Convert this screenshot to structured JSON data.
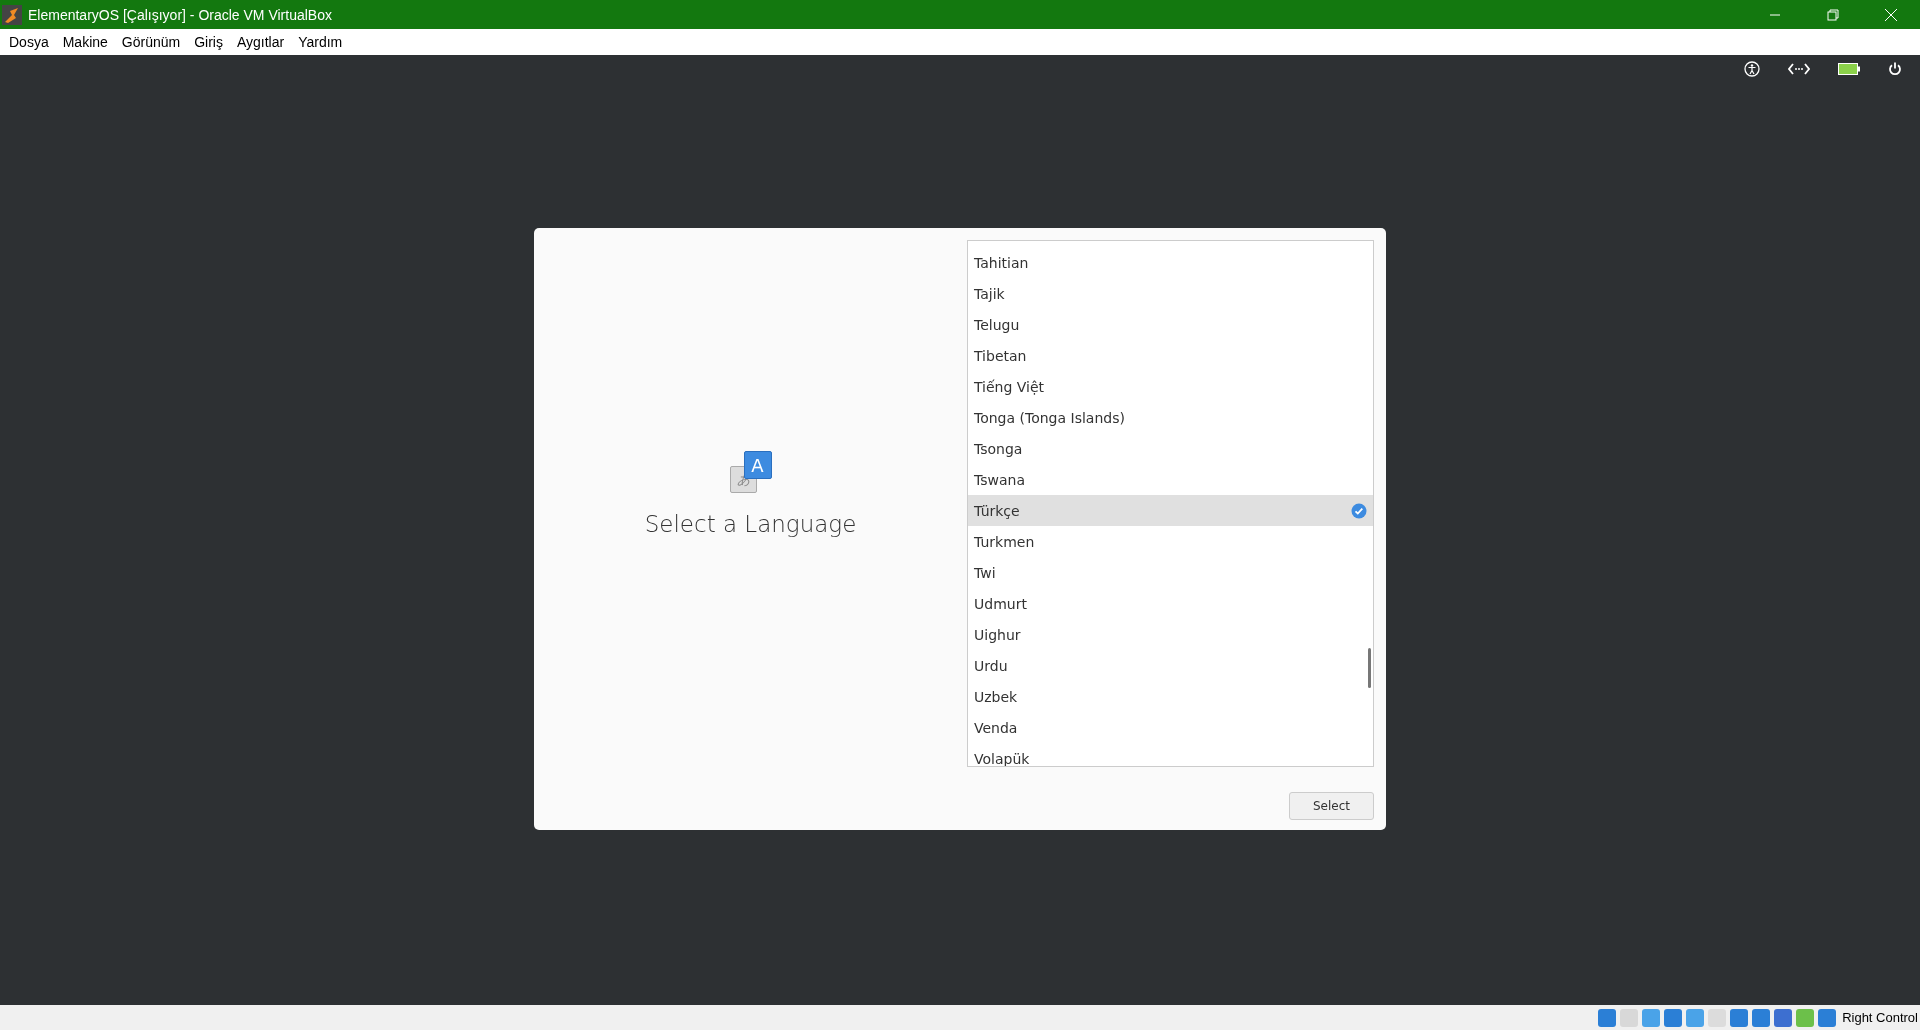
{
  "window": {
    "title": "ElementaryOS [Çalışıyor] - Oracle VM VirtualBox"
  },
  "menu": [
    "Dosya",
    "Makine",
    "Görünüm",
    "Giriş",
    "Aygıtlar",
    "Yardım"
  ],
  "dialog": {
    "heading": "Select a Language",
    "icon_letter": "A",
    "icon_glyph": "あ",
    "languages": [
      {
        "name": "Tahitian",
        "selected": false
      },
      {
        "name": "Tajik",
        "selected": false
      },
      {
        "name": "Telugu",
        "selected": false
      },
      {
        "name": "Tibetan",
        "selected": false
      },
      {
        "name": "Tiếng Việt",
        "selected": false
      },
      {
        "name": "Tonga (Tonga Islands)",
        "selected": false
      },
      {
        "name": "Tsonga",
        "selected": false
      },
      {
        "name": "Tswana",
        "selected": false
      },
      {
        "name": "Türkçe",
        "selected": true
      },
      {
        "name": "Turkmen",
        "selected": false
      },
      {
        "name": "Twi",
        "selected": false
      },
      {
        "name": "Udmurt",
        "selected": false
      },
      {
        "name": "Uighur",
        "selected": false
      },
      {
        "name": "Urdu",
        "selected": false
      },
      {
        "name": "Uzbek",
        "selected": false
      },
      {
        "name": "Venda",
        "selected": false
      },
      {
        "name": "Volapük",
        "selected": false
      }
    ],
    "button": "Select"
  },
  "status_bar": {
    "host_key": "Right Control"
  }
}
